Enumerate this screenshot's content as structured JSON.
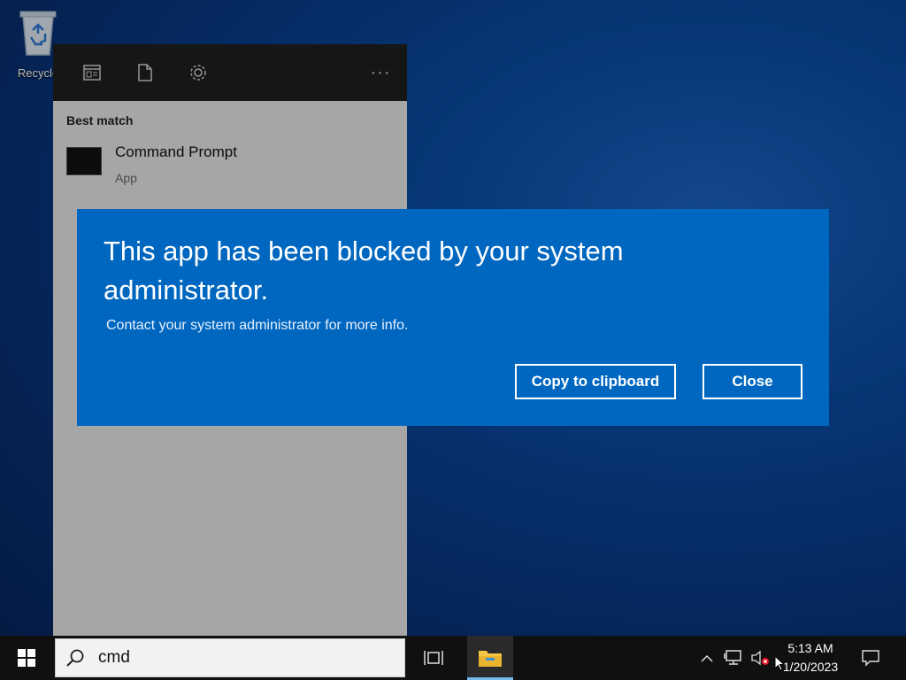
{
  "desktop": {
    "recycle_bin_label": "Recycle"
  },
  "start_panel": {
    "more_label": "···",
    "best_match_heading": "Best match",
    "result": {
      "name": "Command Prompt",
      "kind": "App"
    }
  },
  "dialog": {
    "title": "This app has been blocked by your system administrator.",
    "message": "Contact your system administrator for more info.",
    "copy_button": "Copy to clipboard",
    "close_button": "Close",
    "background_color": "#0067c0"
  },
  "taskbar": {
    "search_value": "cmd",
    "time": "5:13 AM",
    "date": "1/20/2023",
    "icons": [
      "windows-logo-icon",
      "search-icon",
      "task-view-icon",
      "file-explorer-icon",
      "chevron-up-icon",
      "network-icon",
      "volume-muted-icon",
      "notification-icon"
    ]
  }
}
